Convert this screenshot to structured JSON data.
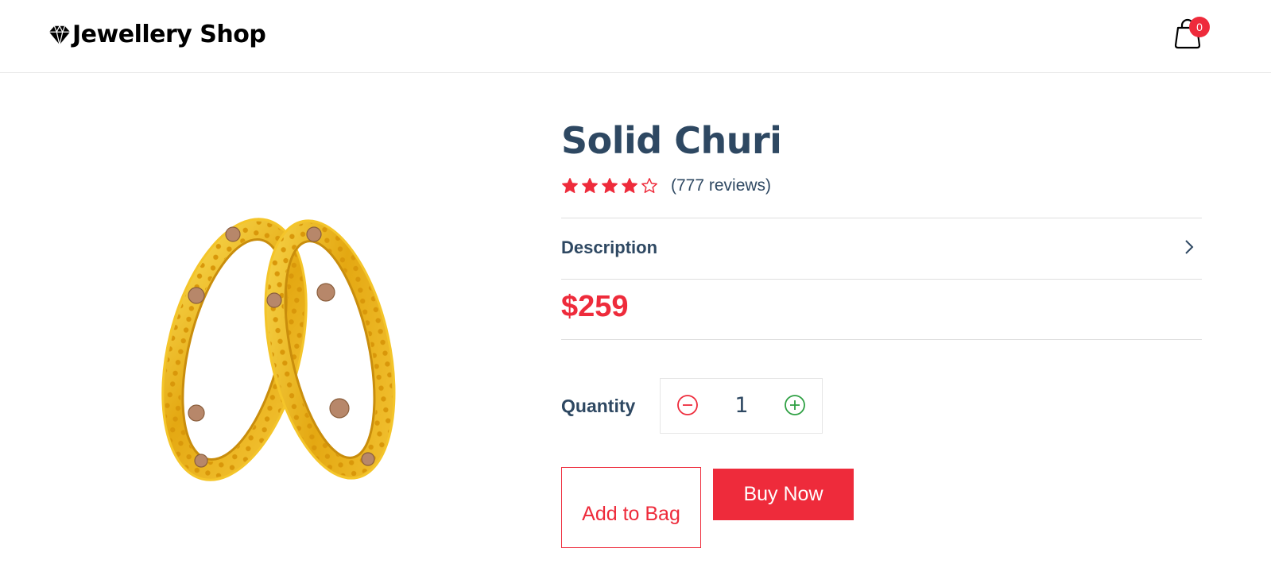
{
  "header": {
    "brand_name": "Jewellery Shop",
    "brand_icon": "diamond-icon",
    "cart_icon": "shopping-bag-icon",
    "cart_count": "0"
  },
  "product": {
    "image_alt": "gold-bangles-image",
    "title": "Solid Churi",
    "rating": 4,
    "rating_max": 5,
    "reviews_text": "(777 reviews)",
    "description_label": "Description",
    "price": "$259",
    "quantity_label": "Quantity",
    "quantity_value": "1",
    "add_to_bag_label": "Add to Bag",
    "buy_now_label": "Buy Now"
  },
  "colors": {
    "accent": "#ee2b3b",
    "text_primary": "#2e4862",
    "plus_green": "#2ea043"
  }
}
